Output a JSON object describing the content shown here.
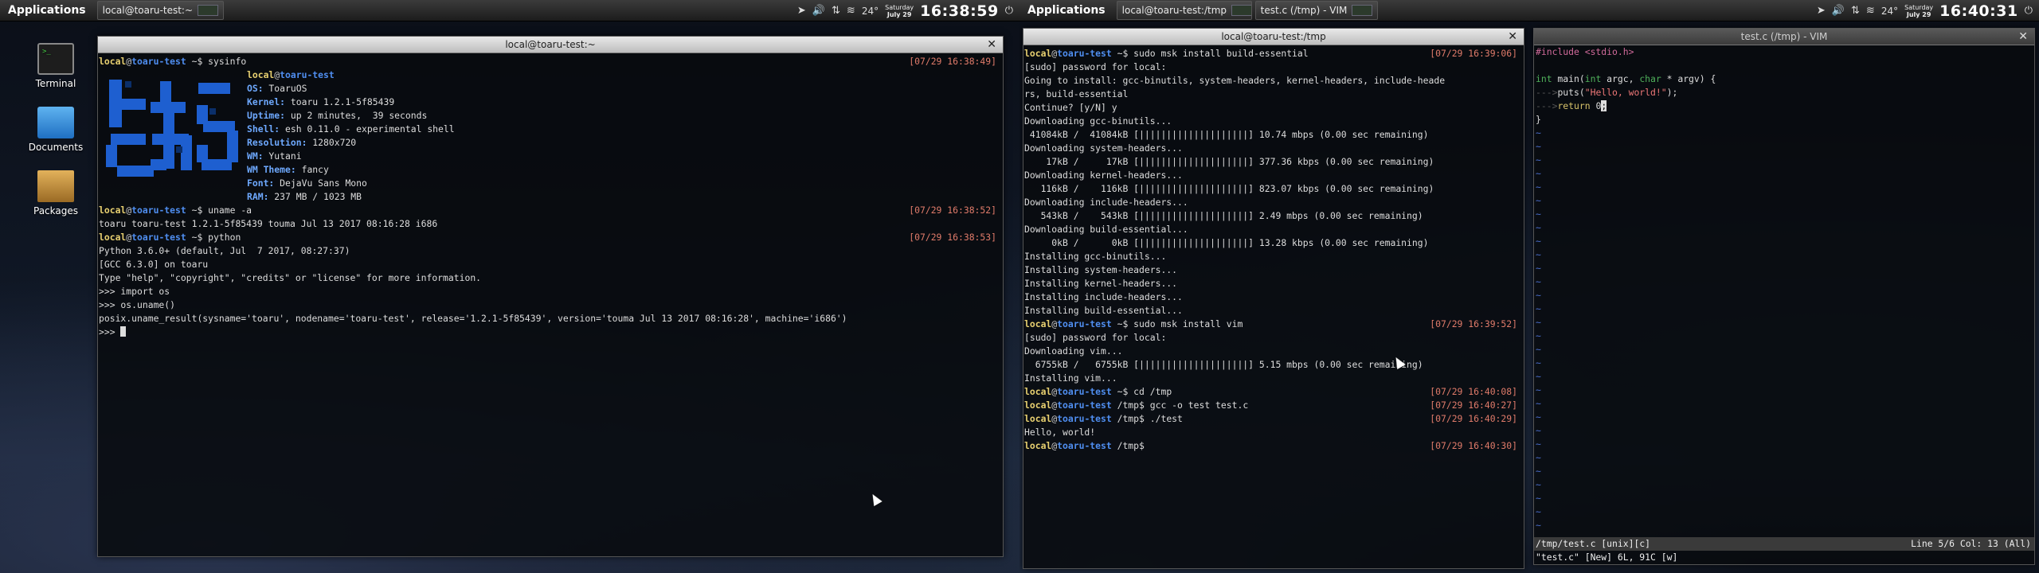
{
  "left_panel": {
    "apps_label": "Applications",
    "task_title": "local@toaru-test:~",
    "weather_temp": "24°",
    "date_day": "Saturday",
    "date_month_day": "July 29",
    "clock": "16:38:59"
  },
  "right_panel": {
    "apps_label": "Applications",
    "task1_title": "local@toaru-test:/tmp",
    "task2_title": "test.c (/tmp) - VIM",
    "weather_temp": "24°",
    "date_day": "Saturday",
    "date_month_day": "July 29",
    "clock": "16:40:31"
  },
  "desktop_icons": {
    "terminal": "Terminal",
    "documents": "Documents",
    "packages": "Packages"
  },
  "term1": {
    "title": "local@toaru-test:~",
    "user": "local",
    "host": "toaru-test",
    "sysinfo": {
      "cmd": "sysinfo",
      "ts": "[07/29 16:38:49]",
      "header": "local@toaru-test",
      "rows": [
        {
          "k": "OS:",
          "v": " ToaruOS"
        },
        {
          "k": "Kernel:",
          "v": " toaru 1.2.1-5f85439"
        },
        {
          "k": "Uptime:",
          "v": " up 2 minutes,  39 seconds"
        },
        {
          "k": "Shell:",
          "v": " esh 0.11.0 - experimental shell"
        },
        {
          "k": "Resolution:",
          "v": " 1280x720"
        },
        {
          "k": "WM:",
          "v": " Yutani"
        },
        {
          "k": "WM Theme:",
          "v": " fancy"
        },
        {
          "k": "Font:",
          "v": " DejaVu Sans Mono"
        },
        {
          "k": "RAM:",
          "v": " 237 MB / 1023 MB"
        }
      ]
    },
    "cmd_uname": "uname -a",
    "ts_uname": "[07/29 16:38:52]",
    "out_uname": "toaru toaru-test 1.2.1-5f85439 touma Jul 13 2017 08:16:28 i686",
    "cmd_python": "python",
    "ts_python": "[07/29 16:38:53]",
    "py_lines": [
      "Python 3.6.0+ (default, Jul  7 2017, 08:27:37)",
      "[GCC 6.3.0] on toaru",
      "Type \"help\", \"copyright\", \"credits\" or \"license\" for more information.",
      ">>> import os",
      ">>> os.uname()",
      "posix.uname_result(sysname='toaru', nodename='toaru-test', release='1.2.1-5f85439', version='touma Jul 13 2017 08:16:28', machine='i686')"
    ],
    "py_prompt": ">>> "
  },
  "term2": {
    "title": "local@toaru-test:/tmp",
    "user": "local",
    "host": "toaru-test",
    "cmd1": "sudo msk install build-essential",
    "ts1": "[07/29 16:39:06]",
    "out1": [
      "[sudo] password for local:",
      "Going to install: gcc-binutils, system-headers, kernel-headers, include-heade",
      "rs, build-essential",
      "Continue? [y/N] y",
      "Downloading gcc-binutils...",
      " 41084kB /  41084kB [||||||||||||||||||||] 10.74 mbps (0.00 sec remaining)",
      "Downloading system-headers...",
      "    17kB /     17kB [||||||||||||||||||||] 377.36 kbps (0.00 sec remaining)",
      "Downloading kernel-headers...",
      "   116kB /    116kB [||||||||||||||||||||] 823.07 kbps (0.00 sec remaining)",
      "Downloading include-headers...",
      "   543kB /    543kB [||||||||||||||||||||] 2.49 mbps (0.00 sec remaining)",
      "Downloading build-essential...",
      "     0kB /      0kB [||||||||||||||||||||] 13.28 kbps (0.00 sec remaining)",
      "Installing gcc-binutils...",
      "Installing system-headers...",
      "Installing kernel-headers...",
      "Installing include-headers...",
      "Installing build-essential..."
    ],
    "cmd2": "sudo msk install vim",
    "ts2": "[07/29 16:39:52]",
    "out2": [
      "[sudo] password for local:",
      "Downloading vim...",
      "  6755kB /   6755kB [||||||||||||||||||||] 5.15 mbps (0.00 sec remaining)",
      "Installing vim..."
    ],
    "path_home": "~",
    "path_tmp": "/tmp",
    "cmd3": "cd /tmp",
    "ts3": "[07/29 16:40:08]",
    "cmd4": "gcc -o test test.c",
    "ts4": "[07/29 16:40:27]",
    "cmd5": "./test",
    "ts5": "[07/29 16:40:29]",
    "out5": "Hello, world!",
    "ts6": "[07/29 16:40:30]"
  },
  "vim": {
    "title": "test.c (/tmp) - VIM",
    "l1": "#include <stdio.h>",
    "l3_type": "int",
    "l3_a": " main(",
    "l3_b": " argc, ",
    "l3_c": "char",
    "l3_d": " * argv) {",
    "l4_tab": "--->",
    "l4_a": "puts(",
    "l4_str": "\"Hello, world!\"",
    "l4_b": ");",
    "l5_tab": "--->",
    "l5_kw": "return",
    "l5_a": " 0",
    "l5_cur": ";",
    "l6": "}",
    "tilde": "~",
    "status_left": "/tmp/test.c [unix][c]",
    "status_right": "Line 5/6 Col: 13 (All)",
    "cmdline": "\"test.c\" [New] 6L, 91C [w]"
  }
}
